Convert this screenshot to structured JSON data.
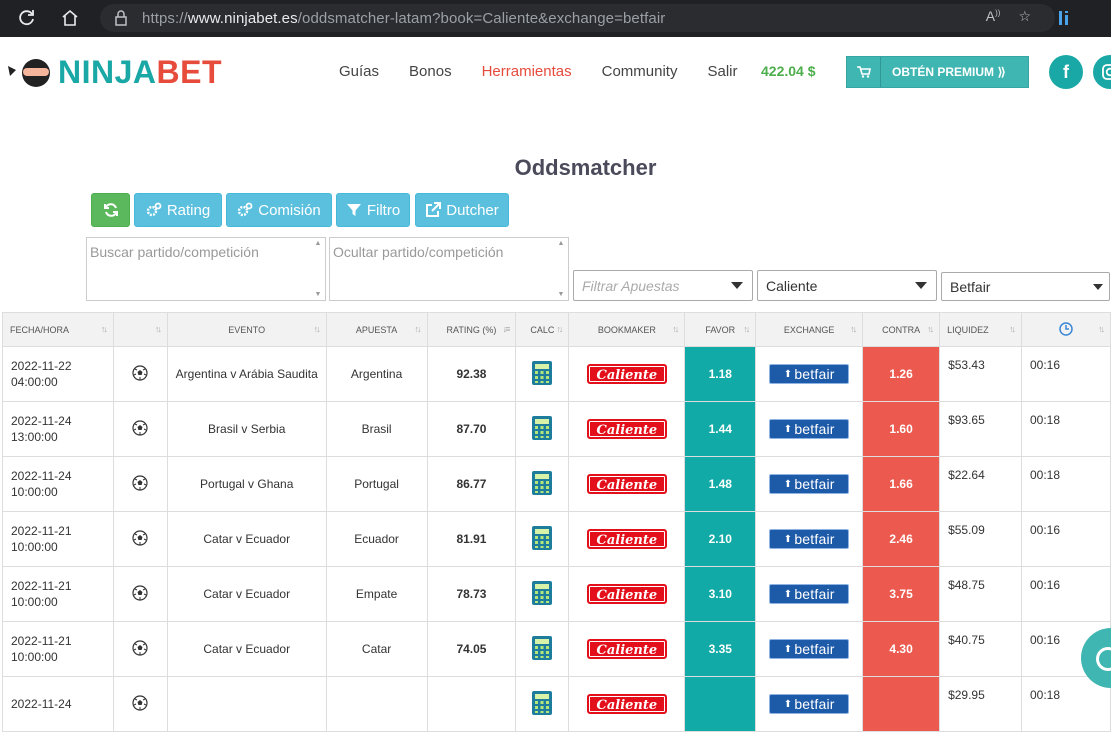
{
  "browser": {
    "url_prefix": "https://",
    "url_domain": "www.ninjabet.es",
    "url_path": "/oddsmatcher-latam?book=Caliente&exchange=betfair"
  },
  "header": {
    "logo_part1": "NINJA",
    "logo_part2": "BET",
    "nav": [
      "Guías",
      "Bonos",
      "Herramientas",
      "Community",
      "Salir"
    ],
    "active_nav": "Herramientas",
    "balance": "422.04 $",
    "premium_label": "OBTÉN PREMIUM ⟫",
    "social_facebook": "f"
  },
  "page_title": "Oddsmatcher",
  "toolbar": {
    "rating_label": "Rating",
    "comision_label": "Comisión",
    "filtro_label": "Filtro",
    "dutcher_label": "Dutcher"
  },
  "filters": {
    "search_placeholder": "Buscar partido/competición",
    "hide_placeholder": "Ocultar partido/competición",
    "bets_placeholder": "Filtrar Apuestas",
    "bookmaker_value": "Caliente",
    "exchange_value": "Betfair"
  },
  "table": {
    "columns": [
      "FECHA/HORA",
      "",
      "EVENTO",
      "APUESTA",
      "RATING (%)",
      "CALC",
      "BOOKMAKER",
      "FAVOR",
      "EXCHANGE",
      "CONTRA",
      "LIQUIDEZ",
      ""
    ],
    "bookmaker_text": "Caliente",
    "exchange_text": "betfair",
    "rows": [
      {
        "date": "2022-11-22",
        "time": "04:00:00",
        "event": "Argentina v Arábia Saudita",
        "bet": "Argentina",
        "rating": "92.38",
        "favor": "1.18",
        "contra": "1.26",
        "liquidity": "$53.43",
        "clock": "00:16"
      },
      {
        "date": "2022-11-24",
        "time": "13:00:00",
        "event": "Brasil v Serbia",
        "bet": "Brasil",
        "rating": "87.70",
        "favor": "1.44",
        "contra": "1.60",
        "liquidity": "$93.65",
        "clock": "00:18"
      },
      {
        "date": "2022-11-24",
        "time": "10:00:00",
        "event": "Portugal v Ghana",
        "bet": "Portugal",
        "rating": "86.77",
        "favor": "1.48",
        "contra": "1.66",
        "liquidity": "$22.64",
        "clock": "00:18"
      },
      {
        "date": "2022-11-21",
        "time": "10:00:00",
        "event": "Catar v Ecuador",
        "bet": "Ecuador",
        "rating": "81.91",
        "favor": "2.10",
        "contra": "2.46",
        "liquidity": "$55.09",
        "clock": "00:16"
      },
      {
        "date": "2022-11-21",
        "time": "10:00:00",
        "event": "Catar v Ecuador",
        "bet": "Empate",
        "rating": "78.73",
        "favor": "3.10",
        "contra": "3.75",
        "liquidity": "$48.75",
        "clock": "00:16"
      },
      {
        "date": "2022-11-21",
        "time": "10:00:00",
        "event": "Catar v Ecuador",
        "bet": "Catar",
        "rating": "74.05",
        "favor": "3.35",
        "contra": "4.30",
        "liquidity": "$40.75",
        "clock": "00:16"
      },
      {
        "date": "2022-11-24",
        "time": "",
        "event": "",
        "bet": "",
        "rating": "",
        "favor": "",
        "contra": "",
        "liquidity": "$29.95",
        "clock": "00:18"
      }
    ]
  },
  "colors": {
    "teal": "#12aaa6",
    "red": "#ec5a4f",
    "green_button": "#5cb85c",
    "blue_button": "#5bc0de",
    "balance": "#4cae4c"
  }
}
